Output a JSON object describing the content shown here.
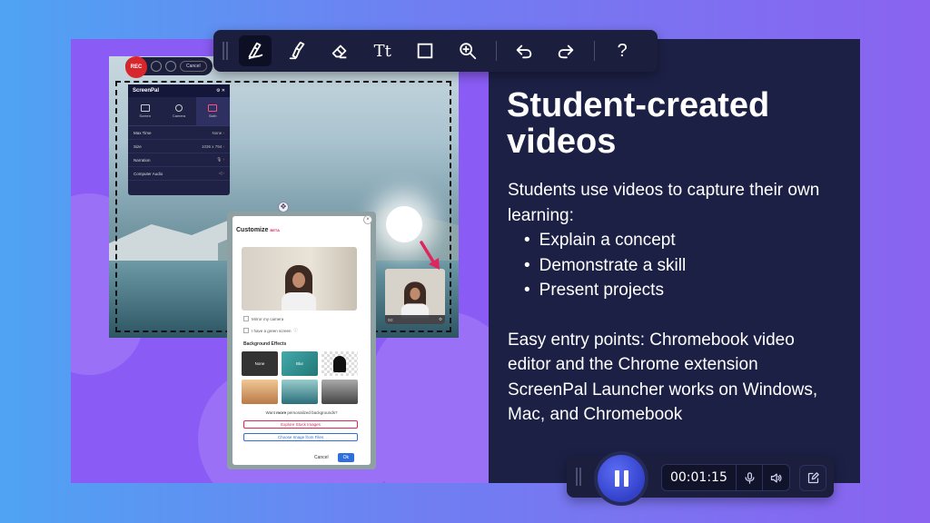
{
  "toolbar": {
    "tools": [
      "pen-tool",
      "highlighter-tool",
      "eraser-tool",
      "text-tool",
      "rectangle-tool",
      "zoom-tool",
      "undo",
      "redo",
      "help"
    ],
    "text_tool_label": "Tt",
    "help_label": "?"
  },
  "screen_recorder": {
    "rec_label": "REC",
    "cancel_label": "Cancel",
    "panel": {
      "logo": "ScreenPal",
      "modes": [
        "Screen",
        "Camera",
        "Both"
      ],
      "active_mode": "Both",
      "settings": [
        {
          "label": "Max Time",
          "value": "None"
        },
        {
          "label": "Size",
          "value": "1036 x 794"
        },
        {
          "label": "Narration",
          "value": ""
        },
        {
          "label": "Computer Audio",
          "value": ""
        }
      ]
    },
    "webcam": {
      "time": "00:"
    }
  },
  "customize": {
    "title": "Customize",
    "beta": "BETA",
    "mirror_label": "Mirror my camera",
    "green_label": "I have a green screen",
    "bg_effects_label": "Background Effects",
    "bg_none_label": "None",
    "bg_blur_label": "Blur",
    "more_prefix": "Want ",
    "more_bold": "more",
    "more_suffix": " personalized backgrounds?",
    "stock_label": "Explore Stock Images",
    "files_label": "Choose Image from Files",
    "cancel_label": "Cancel",
    "ok_label": "Ok"
  },
  "content": {
    "title": "Student-created videos",
    "intro": "Students use videos to capture their own learning:",
    "bullets": [
      "Explain a concept",
      "Demonstrate a skill",
      "Present projects"
    ],
    "para2": "Easy entry points: Chromebook video editor and the Chrome extension ScreenPal Launcher works on Windows, Mac, and Chromebook"
  },
  "recorder": {
    "time": "00:01:15",
    "icons": [
      "microphone-icon",
      "speaker-icon",
      "edit-icon"
    ]
  },
  "colors": {
    "slide_left": "#8a5cf5",
    "slide_right": "#1c2045",
    "toolbar_bg": "#1b1e3d",
    "pause_button": "#3f4fe0",
    "accent_pink": "#e0245e"
  }
}
